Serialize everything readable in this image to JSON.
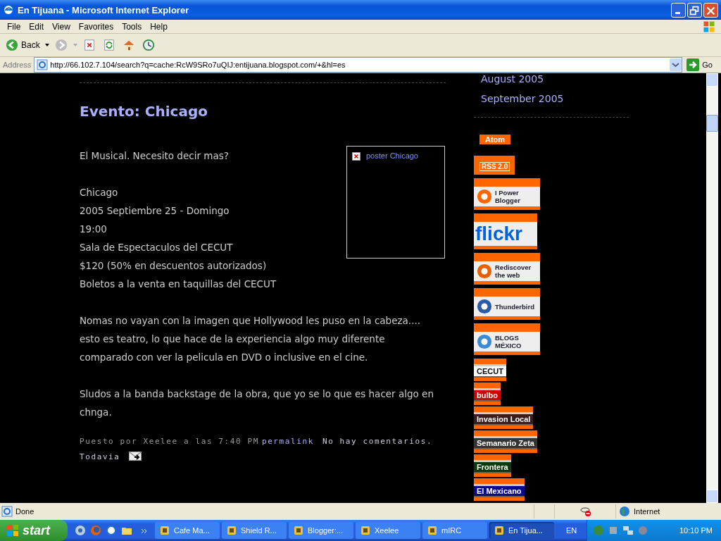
{
  "window": {
    "title": "En Tijuana - Microsoft Internet Explorer"
  },
  "menu": [
    "File",
    "Edit",
    "View",
    "Favorites",
    "Tools",
    "Help"
  ],
  "toolbar": {
    "back": "Back"
  },
  "address": {
    "label": "Address",
    "value": "http://66.102.7.104/search?q=cache:RcW9SRo7uQIJ:entijuana.blogspot.com/+&hl=es",
    "go": "Go"
  },
  "page": {
    "archive_links": [
      "August 2005",
      "September 2005"
    ],
    "post": {
      "title": "Evento: Chicago",
      "poster_alt": "poster Chicago",
      "paragraphs": [
        [
          "El Musical. Necesito decir mas?"
        ],
        [
          "Chicago",
          "2005 Septiembre 25 - Domingo",
          "19:00",
          "Sala de Espectaculos del CECUT",
          "$120 (50% en descuentos autorizados)",
          "Boletos a la venta en taquillas del CECUT"
        ],
        [
          "Nomas no vayan con la imagen que Hollywood les puso en la cabeza.... esto es teatro, lo que hace de la experiencia algo muy diferente comparado con ver la pelicula en DVD o inclusive en el cine."
        ],
        [
          "Sludos a la banda backstage de la obra, que yo se lo que es hacer algo en chnga."
        ]
      ],
      "footer": {
        "posted": "Puesto por Xeelee a las 7:40 PM",
        "permalink": "permalink",
        "comments": [
          "No hay comentarios.",
          "Todavia"
        ]
      }
    },
    "badges": [
      {
        "kind": "plain",
        "label": "Atom",
        "color": "#ff6600"
      },
      {
        "kind": "boxed",
        "label": "RSS 2.0",
        "color": "#ff6600"
      },
      {
        "kind": "logo",
        "label": "I Power Blogger",
        "color": "#ff6600"
      },
      {
        "kind": "wordmark",
        "label": "flickr",
        "color": "#0063dc"
      },
      {
        "kind": "logo",
        "label": "Rediscover the web",
        "color": "#e66000"
      },
      {
        "kind": "logo",
        "label": "Thunderbird",
        "color": "#2a5aa8"
      },
      {
        "kind": "logo",
        "label": "BLOGS MÉXICO",
        "color": "#3a8ad8"
      },
      {
        "kind": "banner",
        "label": "CECUT",
        "color": "#ffffff"
      },
      {
        "kind": "banner",
        "label": "bulbo",
        "color": "#cc0000"
      },
      {
        "kind": "banner",
        "label": "Invasion Local",
        "color": "#3a1c1c"
      },
      {
        "kind": "banner",
        "label": "Semanario Zeta",
        "color": "#333333"
      },
      {
        "kind": "banner",
        "label": "Frontera",
        "color": "#0c3a0c"
      },
      {
        "kind": "banner",
        "label": "El Mexicano",
        "color": "#0a0a88"
      }
    ]
  },
  "status": {
    "text": "Done",
    "zone": "Internet"
  },
  "taskbar": {
    "start": "start",
    "tasks": [
      {
        "label": "Cafe Ma...",
        "selected": false
      },
      {
        "label": "Shield R...",
        "selected": false
      },
      {
        "label": "Blogger:...",
        "selected": false
      },
      {
        "label": "Xeelee",
        "selected": false
      },
      {
        "label": "mIRC",
        "selected": false
      },
      {
        "label": "En Tijua...",
        "selected": true
      }
    ],
    "language": "EN",
    "clock": "10:10 PM"
  }
}
